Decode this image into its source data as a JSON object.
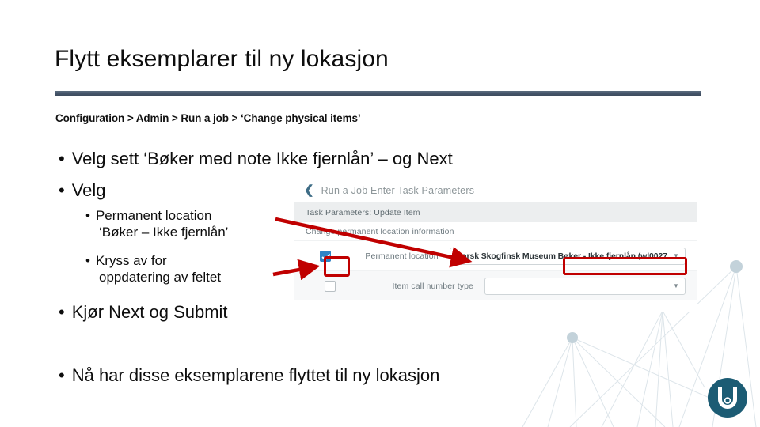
{
  "slide": {
    "title": "Flytt eksemplarer til ny lokasjon",
    "breadcrumb": "Configuration > Admin >  Run a job > ‘Change  physical items’",
    "accent_rule_color": "#44546a",
    "bullets": {
      "velg_sett": "Velg sett ‘Bøker med note Ikke fjernlån’ – og Next",
      "velg": "Velg",
      "permanent_location_line1": "Permanent location",
      "permanent_location_line2": "‘Bøker – Ikke fjernlån’",
      "kryss_line1": "Kryss av for",
      "kryss_line2": "oppdatering av feltet",
      "kjor": "Kjør Next og Submit",
      "naa": "Nå har disse eksemplarene flyttet til ny lokasjon"
    },
    "bullet_marker": "•"
  },
  "screenshot": {
    "back_icon": "chevron-left-icon",
    "header_title": "Run a Job  Enter Task Parameters",
    "section_title": "Task Parameters: Update Item",
    "subsection_title": "Change permanent location information",
    "rows": [
      {
        "checked": true,
        "label": "Permanent location",
        "value": "Norsk Skogfinsk Museum Bøker - Ikke fjernlån (wl0027",
        "caret_icon": "chevron-down-icon"
      },
      {
        "checked": false,
        "label": "Item call number type",
        "value": "",
        "caret_icon": "chevron-down-icon"
      }
    ]
  },
  "annotations": {
    "highlight_color": "#c00000",
    "arrow_to_value_label": "arrow-pointing-to-permanent-location-value",
    "arrow_to_checkbox_label": "arrow-pointing-to-checkbox",
    "highlight_checkbox_label": "highlighted-checkbox",
    "highlight_value_label": "highlighted-location-value"
  },
  "branding": {
    "logo_letter": "U",
    "logo_color": "#1c5c74",
    "node_color": "#c3d2da",
    "line_color": "#dde5ea"
  }
}
